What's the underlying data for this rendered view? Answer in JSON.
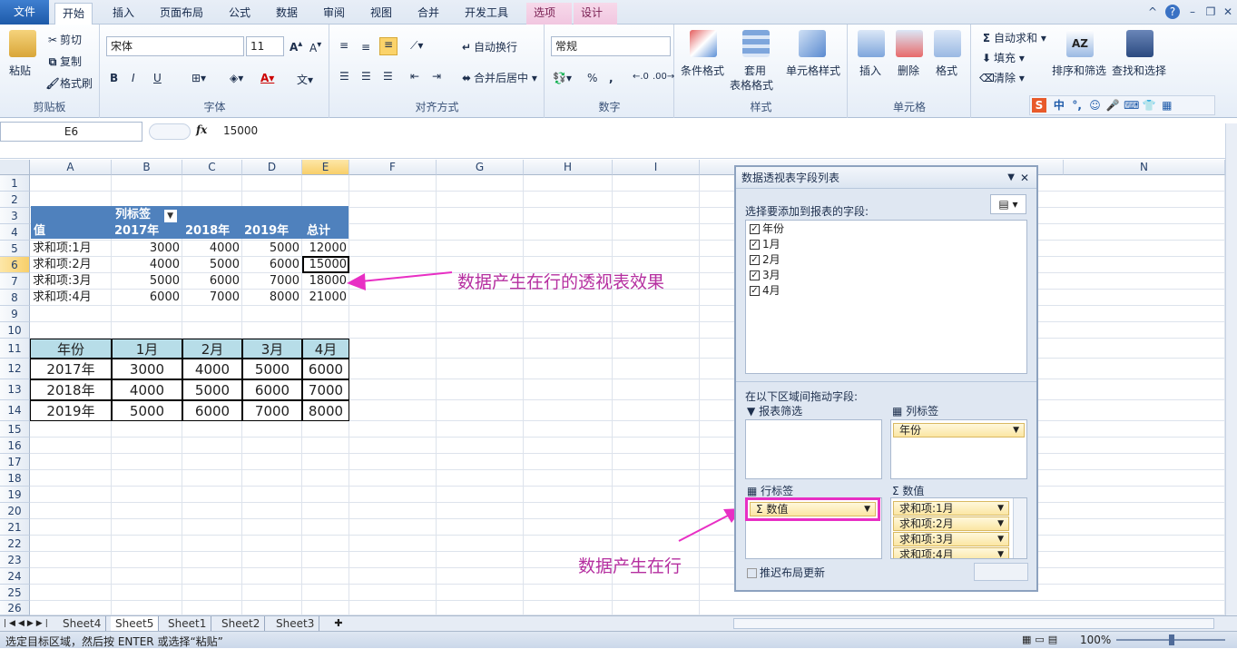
{
  "ribbon_tabs": [
    "文件",
    "开始",
    "插入",
    "页面布局",
    "公式",
    "数据",
    "审阅",
    "视图",
    "合并",
    "开发工具",
    "选项",
    "设计"
  ],
  "clipboard": {
    "paste": "粘贴",
    "cut": "剪切",
    "copy": "复制",
    "format_painter": "格式刷",
    "label": "剪贴板"
  },
  "font": {
    "name": "宋体",
    "size": "11",
    "bold": "B",
    "italic": "I",
    "underline": "U",
    "label": "字体"
  },
  "alignment": {
    "wrap": "自动换行",
    "merge": "合并后居中",
    "label": "对齐方式"
  },
  "number": {
    "format": "常规",
    "percent": "%",
    "comma": ",",
    "label": "数字"
  },
  "styles": {
    "conditional": "条件格式",
    "table_format_1": "套用",
    "table_format_2": "表格格式",
    "cell_styles": "单元格样式",
    "label": "样式"
  },
  "cells": {
    "insert": "插入",
    "delete": "删除",
    "format": "格式",
    "label": "单元格"
  },
  "editing": {
    "autosum": "自动求和",
    "fill": "填充",
    "clear": "清除",
    "sort_filter": "排序和筛选",
    "find_select": "查找和选择"
  },
  "ime": "中",
  "formula_bar": {
    "name_box": "E6",
    "fx": "fx",
    "value": "15000"
  },
  "columns": [
    "A",
    "B",
    "C",
    "D",
    "E",
    "F",
    "G",
    "H",
    "I",
    "N"
  ],
  "rows": [
    "1",
    "2",
    "3",
    "4",
    "5",
    "6",
    "7",
    "8",
    "9",
    "10",
    "11",
    "12",
    "13",
    "14",
    "15",
    "16",
    "17",
    "18",
    "19",
    "20",
    "21",
    "22",
    "23",
    "24",
    "25",
    "26"
  ],
  "pivot": {
    "col_label": "列标签",
    "header": [
      "值",
      "2017年",
      "2018年",
      "2019年",
      "总计"
    ],
    "rows": [
      [
        "求和项:1月",
        "3000",
        "4000",
        "5000",
        "12000"
      ],
      [
        "求和项:2月",
        "4000",
        "5000",
        "6000",
        "15000"
      ],
      [
        "求和项:3月",
        "5000",
        "6000",
        "7000",
        "18000"
      ],
      [
        "求和项:4月",
        "6000",
        "7000",
        "8000",
        "21000"
      ]
    ]
  },
  "source_table": {
    "header": [
      "年份",
      "1月",
      "2月",
      "3月",
      "4月"
    ],
    "rows": [
      [
        "2017年",
        "3000",
        "4000",
        "5000",
        "6000"
      ],
      [
        "2018年",
        "4000",
        "5000",
        "6000",
        "7000"
      ],
      [
        "2019年",
        "5000",
        "6000",
        "7000",
        "8000"
      ]
    ]
  },
  "annotations": {
    "top": "数据产生在行的透视表效果",
    "bottom": "数据产生在行"
  },
  "pane": {
    "title": "数据透视表字段列表",
    "choose_label": "选择要添加到报表的字段:",
    "fields": [
      "年份",
      "1月",
      "2月",
      "3月",
      "4月"
    ],
    "drag_label": "在以下区域间拖动字段:",
    "filter_label": "报表筛选",
    "columns_label": "列标签",
    "rows_label": "行标签",
    "values_label": "数值",
    "column_items": [
      "年份"
    ],
    "row_items": [
      "Σ 数值"
    ],
    "value_items": [
      "求和项:1月",
      "求和项:2月",
      "求和项:3月",
      "求和项:4月"
    ],
    "defer_label": "推迟布局更新"
  },
  "sheets": [
    "Sheet4",
    "Sheet5",
    "Sheet1",
    "Sheet2",
    "Sheet3"
  ],
  "active_sheet": "Sheet5",
  "status": {
    "message": "选定目标区域，然后按 ENTER 或选择“粘贴”",
    "zoom": "100%"
  },
  "colors": {
    "pivot_header": "#4f81bd",
    "source_header": "#b7dde8",
    "annotation": "#b52fa0",
    "highlight": "#e82fc4"
  }
}
